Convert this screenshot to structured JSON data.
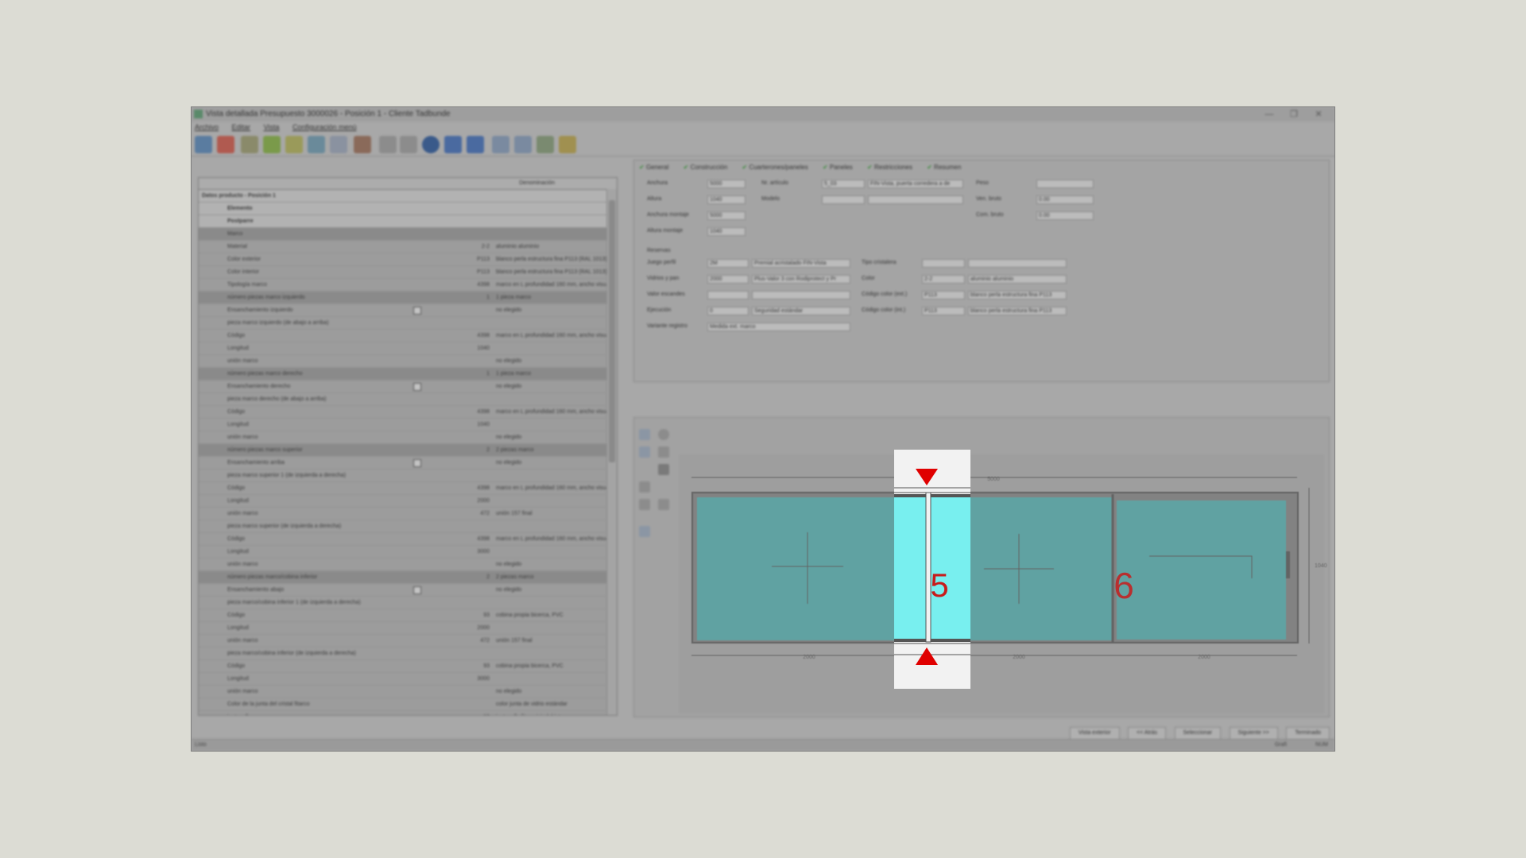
{
  "window": {
    "title": "Vista detallada Presupuesto 3000026 - Posición 1 - Cliente Tadbunde",
    "controls": [
      "—",
      "❐",
      "✕"
    ]
  },
  "menu": [
    "Archivo",
    "Editar",
    "Vista",
    "Configuración menú"
  ],
  "grid": {
    "column_header": "Denominación",
    "title_row": "Datos producto - Posición 1",
    "rows": [
      {
        "label": "Elemento",
        "value": "",
        "desc": "",
        "kind": "hdr"
      },
      {
        "label": "Postparre",
        "value": "",
        "desc": "",
        "kind": "hdr"
      },
      {
        "label": "Marco",
        "value": "",
        "desc": "",
        "kind": "sec"
      },
      {
        "label": "Material",
        "value": "2-2",
        "desc": "aluminio aluminio",
        "kind": ""
      },
      {
        "label": "Color exterior",
        "value": "P113",
        "desc": "blanco perla estructura fina P113 (RAL 1013)",
        "kind": ""
      },
      {
        "label": "Color interior",
        "value": "P113",
        "desc": "blanco perla estructura fina P113 (RAL 1013)",
        "kind": ""
      },
      {
        "label": "Tipología marco",
        "value": "4398",
        "desc": "marco en L profundidad 160 mm, ancho visual exterior",
        "kind": ""
      },
      {
        "label": "número piezas marco izquierdo",
        "value": "1",
        "desc": "1 pieza marco",
        "kind": "sec"
      },
      {
        "label": "Ensanchamiento izquierdo",
        "value": "",
        "desc": "no elegido",
        "kind": "chk"
      },
      {
        "label": "pieza marco izquierdo (de abajo a arriba)",
        "value": "",
        "desc": "",
        "kind": ""
      },
      {
        "label": "Código",
        "value": "4398",
        "desc": "marco en L profundidad 160 mm, ancho visual exterior",
        "kind": ""
      },
      {
        "label": "Longitud",
        "value": "1040",
        "desc": "",
        "kind": ""
      },
      {
        "label": "unión marco",
        "value": "",
        "desc": "no elegido",
        "kind": ""
      },
      {
        "label": "número piezas marco derecho",
        "value": "1",
        "desc": "1 pieza marco",
        "kind": "sec"
      },
      {
        "label": "Ensanchamiento derecho",
        "value": "",
        "desc": "no elegido",
        "kind": "chk"
      },
      {
        "label": "pieza marco derecho (de abajo a arriba)",
        "value": "",
        "desc": "",
        "kind": ""
      },
      {
        "label": "Código",
        "value": "4398",
        "desc": "marco en L profundidad 160 mm, ancho visual exterior",
        "kind": ""
      },
      {
        "label": "Longitud",
        "value": "1040",
        "desc": "",
        "kind": ""
      },
      {
        "label": "unión marco",
        "value": "",
        "desc": "no elegido",
        "kind": ""
      },
      {
        "label": "número piezas marco superior",
        "value": "2",
        "desc": "2 piezas marco",
        "kind": "sec"
      },
      {
        "label": "Ensanchamiento arriba",
        "value": "",
        "desc": "no elegido",
        "kind": "chk"
      },
      {
        "label": "pieza marco superior 1 (de izquierda a derecha)",
        "value": "",
        "desc": "",
        "kind": ""
      },
      {
        "label": "Código",
        "value": "4398",
        "desc": "marco en L profundidad 160 mm, ancho visual exterior",
        "kind": ""
      },
      {
        "label": "Longitud",
        "value": "2000",
        "desc": "",
        "kind": ""
      },
      {
        "label": "unión marco",
        "value": "472",
        "desc": "unión 157 final",
        "kind": ""
      },
      {
        "label": "pieza marco superior (de izquierda a derecha)",
        "value": "",
        "desc": "",
        "kind": ""
      },
      {
        "label": "Código",
        "value": "4398",
        "desc": "marco en L profundidad 160 mm, ancho visual exterior",
        "kind": ""
      },
      {
        "label": "Longitud",
        "value": "3000",
        "desc": "",
        "kind": ""
      },
      {
        "label": "unión marco",
        "value": "",
        "desc": "no elegido",
        "kind": ""
      },
      {
        "label": "número piezas marco/cobina inferior",
        "value": "2",
        "desc": "2 piezas marco",
        "kind": "sec"
      },
      {
        "label": "Ensanchamiento abajo",
        "value": "",
        "desc": "no elegido",
        "kind": "chk"
      },
      {
        "label": "pieza marco/cobina inferior 1 (de izquierda a derecha)",
        "value": "",
        "desc": "",
        "kind": ""
      },
      {
        "label": "Código",
        "value": "93",
        "desc": "cobina propia bicerca, PVC",
        "kind": ""
      },
      {
        "label": "Longitud",
        "value": "2000",
        "desc": "",
        "kind": ""
      },
      {
        "label": "unión marco",
        "value": "472",
        "desc": "unión 157 final",
        "kind": ""
      },
      {
        "label": "pieza marco/cobina inferior (de izquierda a derecha)",
        "value": "",
        "desc": "",
        "kind": ""
      },
      {
        "label": "Código",
        "value": "93",
        "desc": "cobina propia bicerca, PVC",
        "kind": ""
      },
      {
        "label": "Longitud",
        "value": "3000",
        "desc": "",
        "kind": ""
      },
      {
        "label": "unión marco",
        "value": "",
        "desc": "no elegido",
        "kind": ""
      },
      {
        "label": "Color de la junta del cristal fitarco",
        "value": "",
        "desc": "color junta de vidrio estándar",
        "kind": ""
      },
      {
        "label": "juntapollo",
        "value": "10",
        "desc": "juntapollo fitura, izindalrista",
        "kind": ""
      },
      {
        "label": "juntapollo de aluminio combinidade vuelto",
        "value": "",
        "desc": "no elegido",
        "kind": "chk"
      },
      {
        "label": "Introducir cotas",
        "value": "",
        "desc": "elegido",
        "kind": "chk"
      }
    ]
  },
  "tabs": [
    "General",
    "Construcción",
    "Cuarterones/paneles",
    "Paneles",
    "Restricciones",
    "Resumen"
  ],
  "general_form": {
    "left": [
      {
        "label": "Anchura",
        "value": "5000"
      },
      {
        "label": "Altura",
        "value": "1040"
      },
      {
        "label": "Anchura montaje",
        "value": "5000"
      },
      {
        "label": "Altura montaje",
        "value": "1040"
      }
    ],
    "mid": [
      {
        "label": "Nr. artículo",
        "value": "5_03",
        "extra": "FIN-Vista, puerta corredera a de"
      },
      {
        "label": "Modelo",
        "value": "",
        "extra": ""
      }
    ],
    "right": [
      {
        "label": "Peso",
        "value": ""
      },
      {
        "label": "Ven. bruto",
        "value": "0.00"
      },
      {
        "label": "Com. bruto",
        "value": "0.00"
      }
    ],
    "reserves_title": "Reservas",
    "reserves": [
      {
        "label": "Juego perfil",
        "value": "2M",
        "extra": "Premial acristalado FIN-Vista"
      },
      {
        "label": "Vidrios y pan",
        "value": "2000",
        "extra": "Plus-Valor 3 con Rodiprotect y Pr"
      },
      {
        "label": "Valor escandes",
        "value": "",
        "extra": ""
      },
      {
        "label": "Ejecución",
        "value": "0",
        "extra": "Seguridad estándar"
      },
      {
        "label": "Variante registro",
        "value": "Medida ext. marco",
        "extra": ""
      }
    ],
    "reserves_right": [
      {
        "label": "Tipo cristalera",
        "value": "",
        "extra": ""
      },
      {
        "label": "Color",
        "value": "2-2",
        "extra": "aluminio aluminio"
      },
      {
        "label": "Código color (ext.)",
        "value": "P113",
        "extra": "blanco perla estructura fina P113"
      },
      {
        "label": "Código color (int.)",
        "value": "P113",
        "extra": "blanco perla estructura fina P113"
      }
    ]
  },
  "drawing": {
    "total_width": "5000",
    "height": "1040",
    "segments": [
      "2000",
      "2000",
      "2000"
    ],
    "highlight_label": "5",
    "panel_label": "6",
    "glass_color": "#2fa7a7",
    "highlight_glass_color": "#78efef",
    "arrow_color": "#e00000",
    "label_color": "#c81c1c"
  },
  "bottom_buttons": [
    "Vista exterior",
    "<< Atrás",
    "Seleccionar",
    "Siguiente >>",
    "Terminado"
  ],
  "status": {
    "left": "Listo",
    "right1": "Grafi",
    "right2": "NUM"
  }
}
